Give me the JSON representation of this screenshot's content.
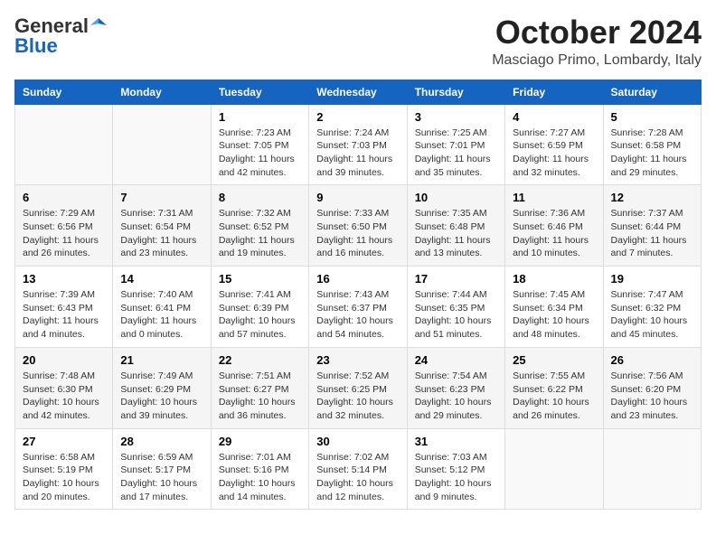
{
  "header": {
    "logo_general": "General",
    "logo_blue": "Blue",
    "month": "October 2024",
    "location": "Masciago Primo, Lombardy, Italy"
  },
  "weekdays": [
    "Sunday",
    "Monday",
    "Tuesday",
    "Wednesday",
    "Thursday",
    "Friday",
    "Saturday"
  ],
  "weeks": [
    [
      {
        "day": "",
        "info": ""
      },
      {
        "day": "",
        "info": ""
      },
      {
        "day": "1",
        "info": "Sunrise: 7:23 AM\nSunset: 7:05 PM\nDaylight: 11 hours and 42 minutes."
      },
      {
        "day": "2",
        "info": "Sunrise: 7:24 AM\nSunset: 7:03 PM\nDaylight: 11 hours and 39 minutes."
      },
      {
        "day": "3",
        "info": "Sunrise: 7:25 AM\nSunset: 7:01 PM\nDaylight: 11 hours and 35 minutes."
      },
      {
        "day": "4",
        "info": "Sunrise: 7:27 AM\nSunset: 6:59 PM\nDaylight: 11 hours and 32 minutes."
      },
      {
        "day": "5",
        "info": "Sunrise: 7:28 AM\nSunset: 6:58 PM\nDaylight: 11 hours and 29 minutes."
      }
    ],
    [
      {
        "day": "6",
        "info": "Sunrise: 7:29 AM\nSunset: 6:56 PM\nDaylight: 11 hours and 26 minutes."
      },
      {
        "day": "7",
        "info": "Sunrise: 7:31 AM\nSunset: 6:54 PM\nDaylight: 11 hours and 23 minutes."
      },
      {
        "day": "8",
        "info": "Sunrise: 7:32 AM\nSunset: 6:52 PM\nDaylight: 11 hours and 19 minutes."
      },
      {
        "day": "9",
        "info": "Sunrise: 7:33 AM\nSunset: 6:50 PM\nDaylight: 11 hours and 16 minutes."
      },
      {
        "day": "10",
        "info": "Sunrise: 7:35 AM\nSunset: 6:48 PM\nDaylight: 11 hours and 13 minutes."
      },
      {
        "day": "11",
        "info": "Sunrise: 7:36 AM\nSunset: 6:46 PM\nDaylight: 11 hours and 10 minutes."
      },
      {
        "day": "12",
        "info": "Sunrise: 7:37 AM\nSunset: 6:44 PM\nDaylight: 11 hours and 7 minutes."
      }
    ],
    [
      {
        "day": "13",
        "info": "Sunrise: 7:39 AM\nSunset: 6:43 PM\nDaylight: 11 hours and 4 minutes."
      },
      {
        "day": "14",
        "info": "Sunrise: 7:40 AM\nSunset: 6:41 PM\nDaylight: 11 hours and 0 minutes."
      },
      {
        "day": "15",
        "info": "Sunrise: 7:41 AM\nSunset: 6:39 PM\nDaylight: 10 hours and 57 minutes."
      },
      {
        "day": "16",
        "info": "Sunrise: 7:43 AM\nSunset: 6:37 PM\nDaylight: 10 hours and 54 minutes."
      },
      {
        "day": "17",
        "info": "Sunrise: 7:44 AM\nSunset: 6:35 PM\nDaylight: 10 hours and 51 minutes."
      },
      {
        "day": "18",
        "info": "Sunrise: 7:45 AM\nSunset: 6:34 PM\nDaylight: 10 hours and 48 minutes."
      },
      {
        "day": "19",
        "info": "Sunrise: 7:47 AM\nSunset: 6:32 PM\nDaylight: 10 hours and 45 minutes."
      }
    ],
    [
      {
        "day": "20",
        "info": "Sunrise: 7:48 AM\nSunset: 6:30 PM\nDaylight: 10 hours and 42 minutes."
      },
      {
        "day": "21",
        "info": "Sunrise: 7:49 AM\nSunset: 6:29 PM\nDaylight: 10 hours and 39 minutes."
      },
      {
        "day": "22",
        "info": "Sunrise: 7:51 AM\nSunset: 6:27 PM\nDaylight: 10 hours and 36 minutes."
      },
      {
        "day": "23",
        "info": "Sunrise: 7:52 AM\nSunset: 6:25 PM\nDaylight: 10 hours and 32 minutes."
      },
      {
        "day": "24",
        "info": "Sunrise: 7:54 AM\nSunset: 6:23 PM\nDaylight: 10 hours and 29 minutes."
      },
      {
        "day": "25",
        "info": "Sunrise: 7:55 AM\nSunset: 6:22 PM\nDaylight: 10 hours and 26 minutes."
      },
      {
        "day": "26",
        "info": "Sunrise: 7:56 AM\nSunset: 6:20 PM\nDaylight: 10 hours and 23 minutes."
      }
    ],
    [
      {
        "day": "27",
        "info": "Sunrise: 6:58 AM\nSunset: 5:19 PM\nDaylight: 10 hours and 20 minutes."
      },
      {
        "day": "28",
        "info": "Sunrise: 6:59 AM\nSunset: 5:17 PM\nDaylight: 10 hours and 17 minutes."
      },
      {
        "day": "29",
        "info": "Sunrise: 7:01 AM\nSunset: 5:16 PM\nDaylight: 10 hours and 14 minutes."
      },
      {
        "day": "30",
        "info": "Sunrise: 7:02 AM\nSunset: 5:14 PM\nDaylight: 10 hours and 12 minutes."
      },
      {
        "day": "31",
        "info": "Sunrise: 7:03 AM\nSunset: 5:12 PM\nDaylight: 10 hours and 9 minutes."
      },
      {
        "day": "",
        "info": ""
      },
      {
        "day": "",
        "info": ""
      }
    ]
  ]
}
